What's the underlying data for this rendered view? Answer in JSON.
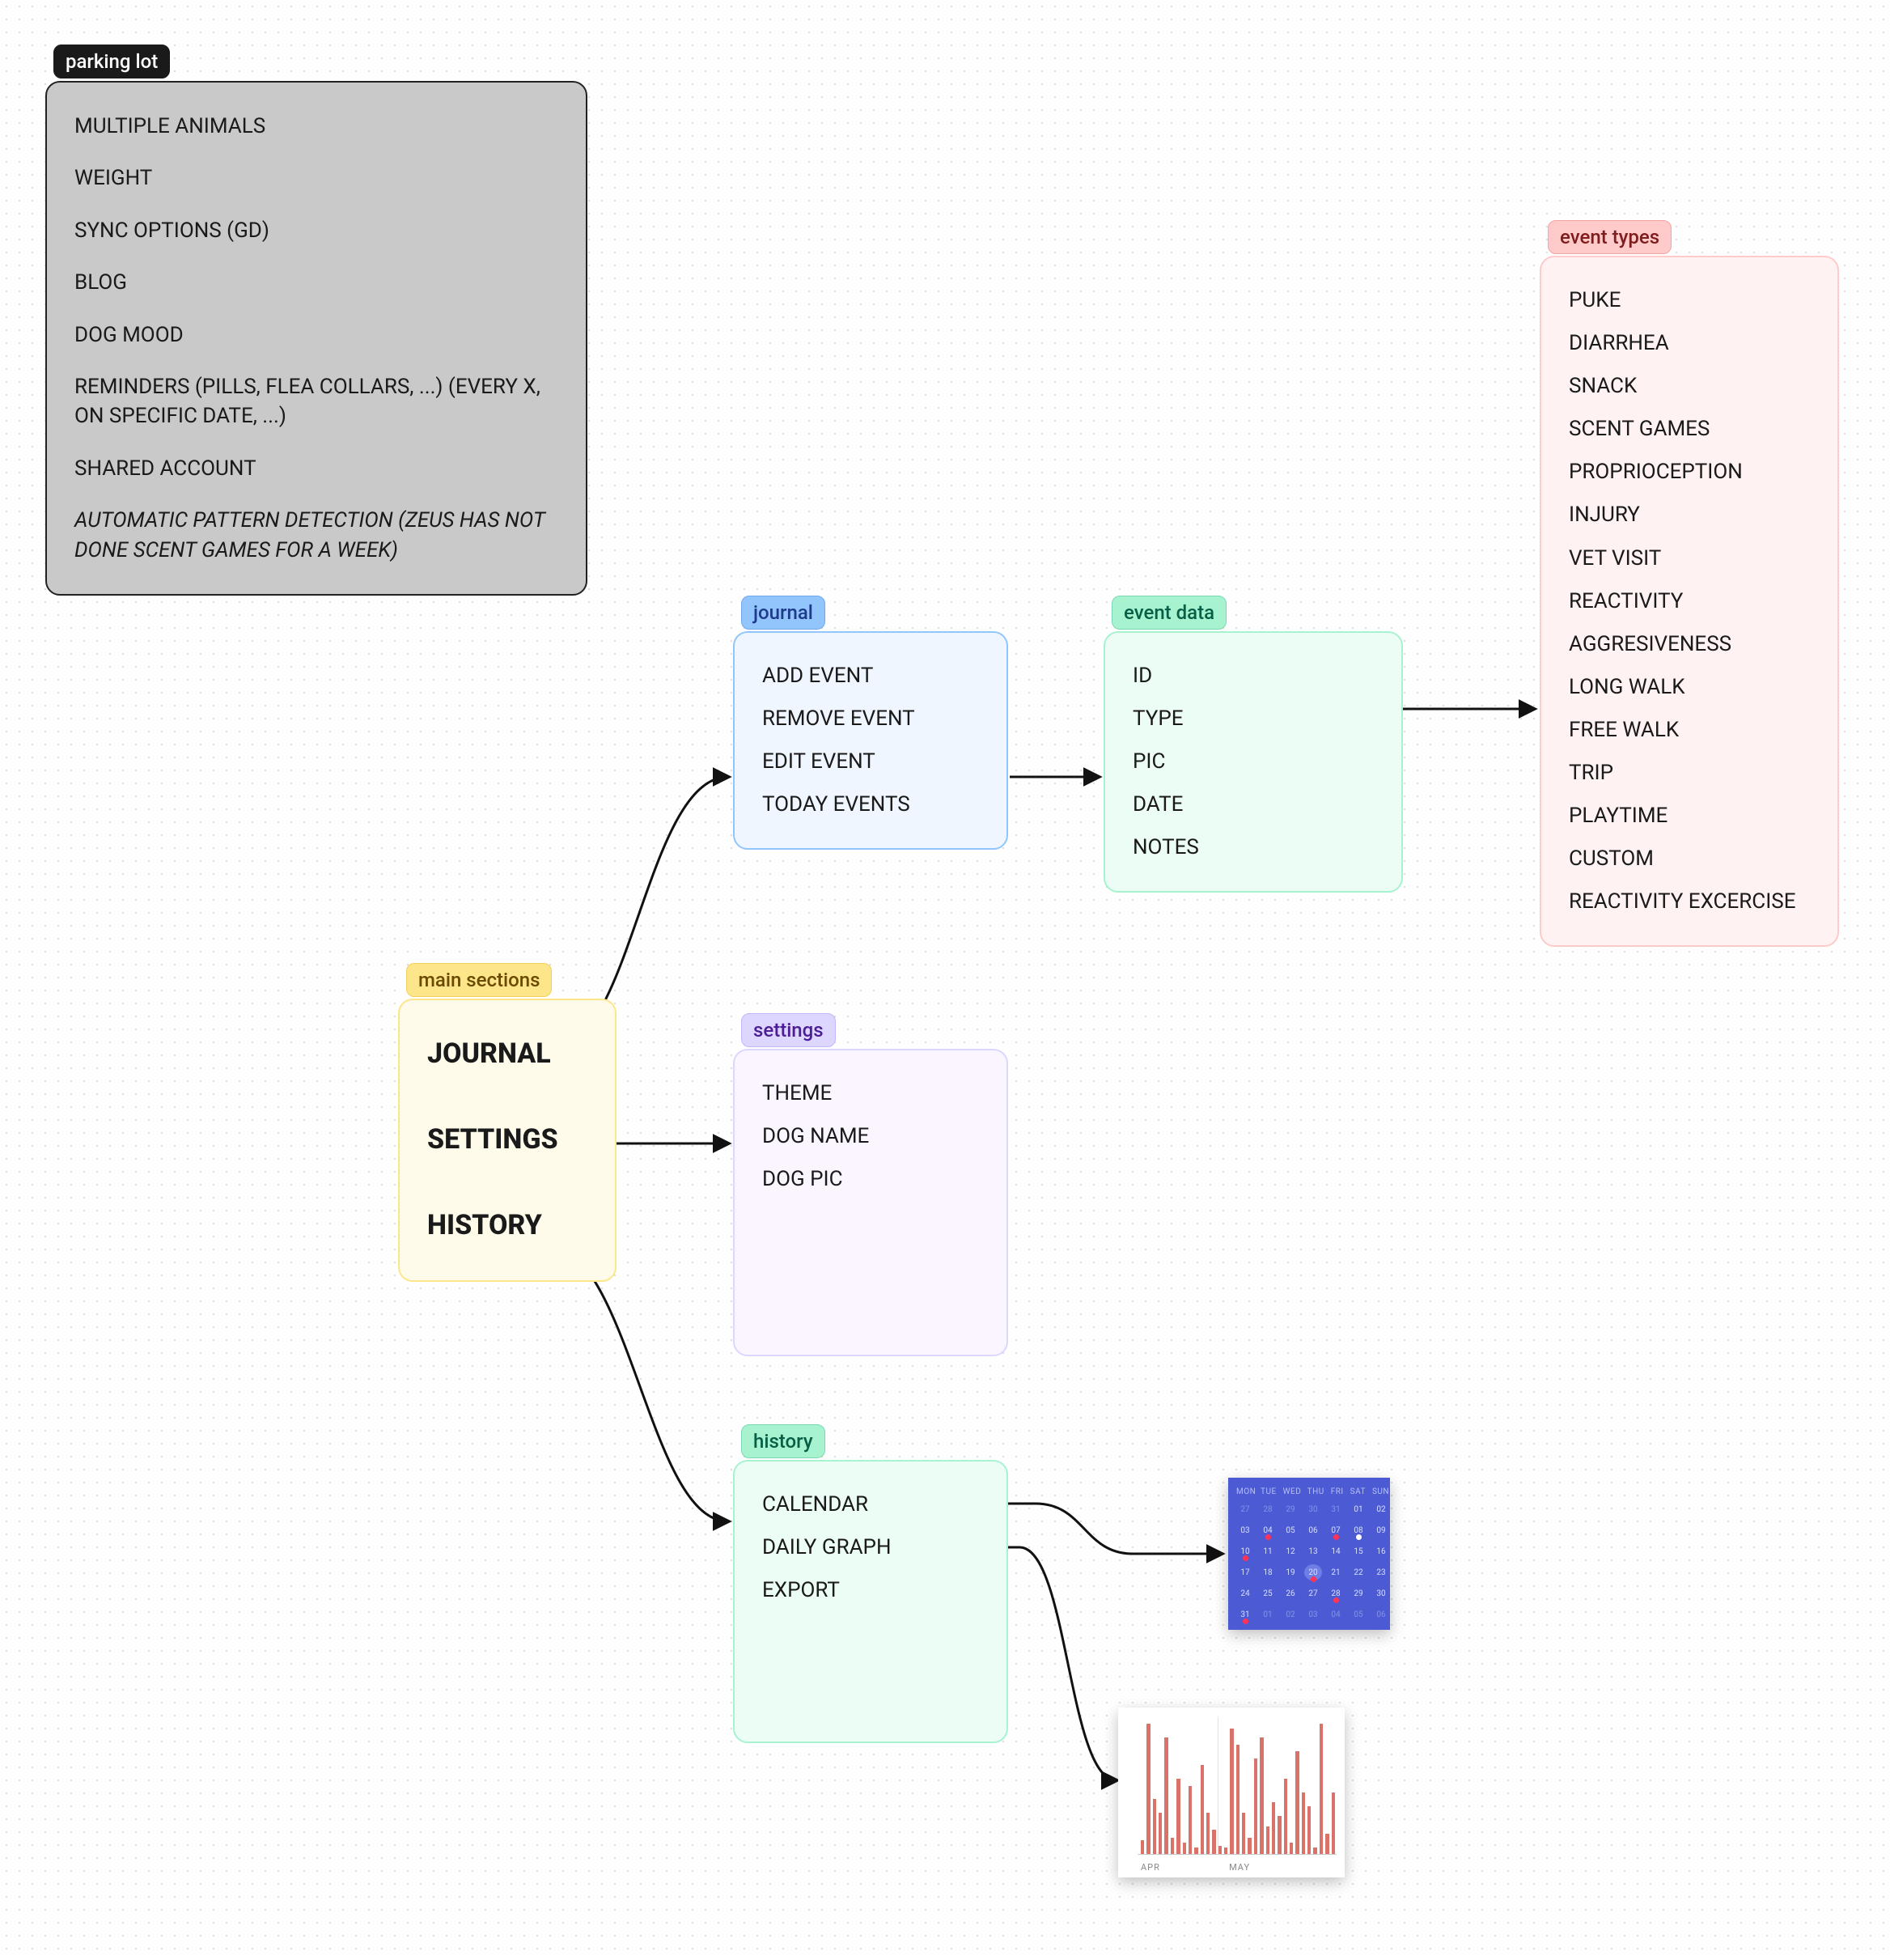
{
  "parkingLot": {
    "label": "parking lot",
    "items": [
      "MULTIPLE ANIMALS",
      "WEIGHT",
      "SYNC OPTIONS (GD)",
      "BLOG",
      "DOG MOOD",
      "REMINDERS (PILLS, FLEA COLLARS, ...) (EVERY X, ON SPECIFIC DATE, ...)",
      "SHARED ACCOUNT",
      "AUTOMATIC PATTERN DETECTION (ZEUS HAS NOT DONE SCENT GAMES FOR A WEEK)"
    ]
  },
  "mainSections": {
    "label": "main sections",
    "items": [
      "JOURNAL",
      "SETTINGS",
      "HISTORY"
    ]
  },
  "journal": {
    "label": "journal",
    "items": [
      "ADD EVENT",
      "REMOVE EVENT",
      "EDIT EVENT",
      "TODAY EVENTS"
    ]
  },
  "settings": {
    "label": "settings",
    "items": [
      "THEME",
      "DOG NAME",
      "DOG PIC"
    ]
  },
  "history": {
    "label": "history",
    "items": [
      "CALENDAR",
      "DAILY GRAPH",
      "EXPORT"
    ]
  },
  "eventData": {
    "label": "event data",
    "items": [
      "ID",
      "TYPE",
      "PIC",
      "DATE",
      "NOTES"
    ]
  },
  "eventTypes": {
    "label": "event types",
    "items": [
      "PUKE",
      "DIARRHEA",
      "SNACK",
      "SCENT GAMES",
      "PROPRIOCEPTION",
      "INJURY",
      "VET VISIT",
      "REACTIVITY",
      "AGGRESIVENESS",
      "LONG WALK",
      "FREE WALK",
      "TRIP",
      "PLAYTIME",
      "CUSTOM",
      "REACTIVITY EXCERCISE"
    ]
  },
  "thumbnails": {
    "calendar": {
      "dow": [
        "MON",
        "TUE",
        "WED",
        "THU",
        "FRI",
        "SAT",
        "SUN"
      ],
      "days": [
        [
          "27",
          "28",
          "29",
          "30",
          "31",
          "01",
          "02"
        ],
        [
          "03",
          "04",
          "05",
          "06",
          "07",
          "08",
          "09"
        ],
        [
          "10",
          "11",
          "12",
          "13",
          "14",
          "15",
          "16"
        ],
        [
          "17",
          "18",
          "19",
          "20",
          "21",
          "22",
          "23"
        ],
        [
          "24",
          "25",
          "26",
          "27",
          "28",
          "29",
          "30"
        ],
        [
          "31",
          "01",
          "02",
          "03",
          "04",
          "05",
          "06"
        ]
      ]
    },
    "graph": {
      "months": [
        "APR",
        "MAY"
      ]
    }
  }
}
